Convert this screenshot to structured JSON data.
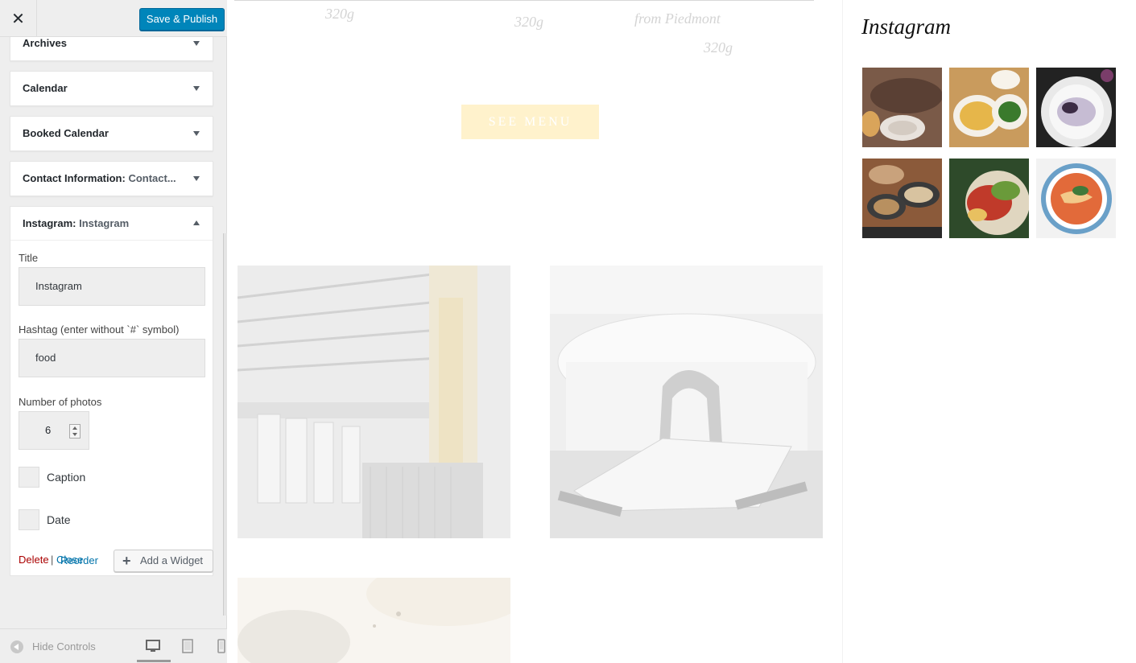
{
  "header": {
    "save_label": "Save & Publish"
  },
  "widgets": [
    {
      "title": "Archives",
      "sub": ""
    },
    {
      "title": "Calendar",
      "sub": ""
    },
    {
      "title": "Booked Calendar",
      "sub": ""
    },
    {
      "title": "Contact Information: ",
      "sub": "Contact..."
    }
  ],
  "instagram_widget": {
    "title": "Instagram: ",
    "sub": "Instagram",
    "title_label": "Title",
    "title_value": "Instagram",
    "hashtag_label": "Hashtag (enter without `#` symbol)",
    "hashtag_value": "food",
    "photos_label": "Number of photos",
    "photos_value": "6",
    "caption_label": "Caption",
    "date_label": "Date",
    "delete_label": "Delete",
    "separator": "|",
    "close_label": "Close"
  },
  "actions": {
    "reorder_label": "Reorder",
    "add_widget_label": "Add a Widget"
  },
  "footer": {
    "hide_controls_label": "Hide Controls"
  },
  "preview": {
    "menu_weights": [
      "320g",
      "320g",
      "from Piedmont",
      "320g"
    ],
    "see_menu_label": "SEE MENU",
    "instagram_heading": "Instagram"
  },
  "colors": {
    "accent": "#0085ba",
    "link": "#0073aa",
    "delete": "#aa0000",
    "button_cream": "#fff2cc"
  }
}
